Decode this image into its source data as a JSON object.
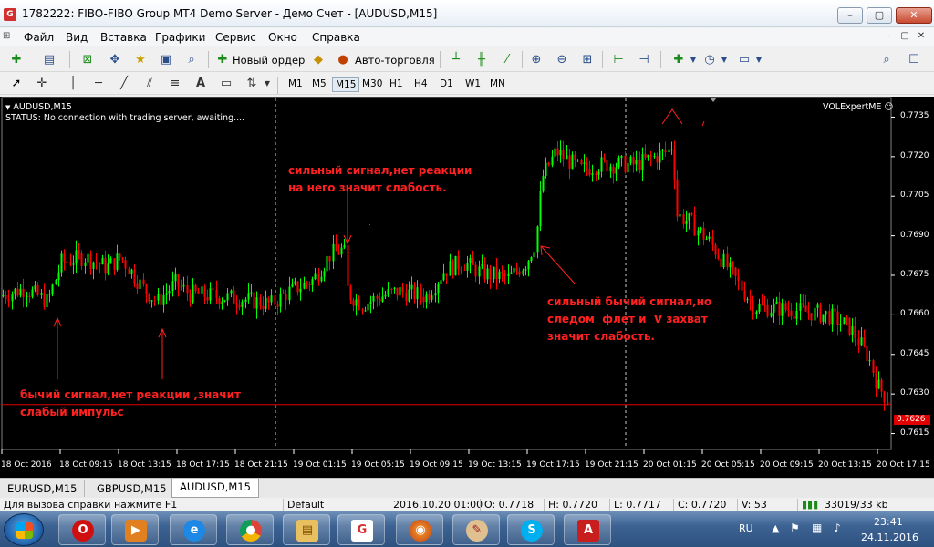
{
  "window": {
    "title": "1782222: FIBO-FIBO Group MT4 Demo Server - Демо Счет - [AUDUSD,M15]",
    "controls": [
      "–",
      "▢",
      "✕"
    ]
  },
  "menu": [
    "Файл",
    "Вид",
    "Вставка",
    "Графики",
    "Сервис",
    "Окно",
    "Справка"
  ],
  "toolbar": {
    "new_order": "Новый ордер",
    "auto_trading": "Авто-торговля",
    "timeframes": [
      "M1",
      "M5",
      "M15",
      "M30",
      "H1",
      "H4",
      "D1",
      "W1",
      "MN"
    ],
    "active_timeframe": "M15"
  },
  "chart": {
    "symbol_label": "AUDUSD,M15",
    "status_text": "STATUS:   No connection with trading server, awaiting....",
    "expert": "VOLExpertME",
    "current_price": "0.7626",
    "price_ticks": [
      "0.7735",
      "0.7720",
      "0.7705",
      "0.7690",
      "0.7675",
      "0.7660",
      "0.7645",
      "0.7630",
      "0.7615"
    ],
    "time_ticks": [
      "18 Oct 2016",
      "18 Oct 09:15",
      "18 Oct 13:15",
      "18 Oct 17:15",
      "18 Oct 21:15",
      "19 Oct 01:15",
      "19 Oct 05:15",
      "19 Oct 09:15",
      "19 Oct 13:15",
      "19 Oct 17:15",
      "19 Oct 21:15",
      "20 Oct 01:15",
      "20 Oct 05:15",
      "20 Oct 09:15",
      "20 Oct 13:15",
      "20 Oct 17:15"
    ],
    "colors": {
      "background": "#000000",
      "bull": "#00ff00",
      "bear": "#ff0000",
      "annotation": "#ff2020",
      "current_price_line": "#e00000"
    },
    "annotations": [
      {
        "text": "сильный сигнал,нет реакции\nна него значит слабость."
      },
      {
        "text": "сильный бычий сигнал,но\nследом  флет и  V захват\nзначит слабость."
      },
      {
        "text": "бычий сигнал,нет реакции ,значит\nслабый импульс"
      }
    ]
  },
  "tabs": [
    "EURUSD,M15",
    "GBPUSD,M15",
    "AUDUSD,M15"
  ],
  "active_tab": "AUDUSD,M15",
  "statusbar": {
    "help": "Для вызова справки нажмите F1",
    "profile": "Default",
    "time": "2016.10.20 01:00",
    "open": "O: 0.7718",
    "high": "H: 0.7720",
    "low": "L: 0.7717",
    "close": "C: 0.7720",
    "volume": "V: 53",
    "traffic": "33019/33 kb"
  },
  "taskbar": {
    "apps": [
      "opera-icon",
      "media-player-icon",
      "internet-explorer-icon",
      "chrome-icon",
      "explorer-folder-icon",
      "fibo-group-icon",
      "firefox-icon",
      "paint-icon",
      "skype-icon",
      "acrobat-icon"
    ],
    "language": "RU",
    "clock_time": "23:41",
    "clock_date": "24.11.2016"
  }
}
